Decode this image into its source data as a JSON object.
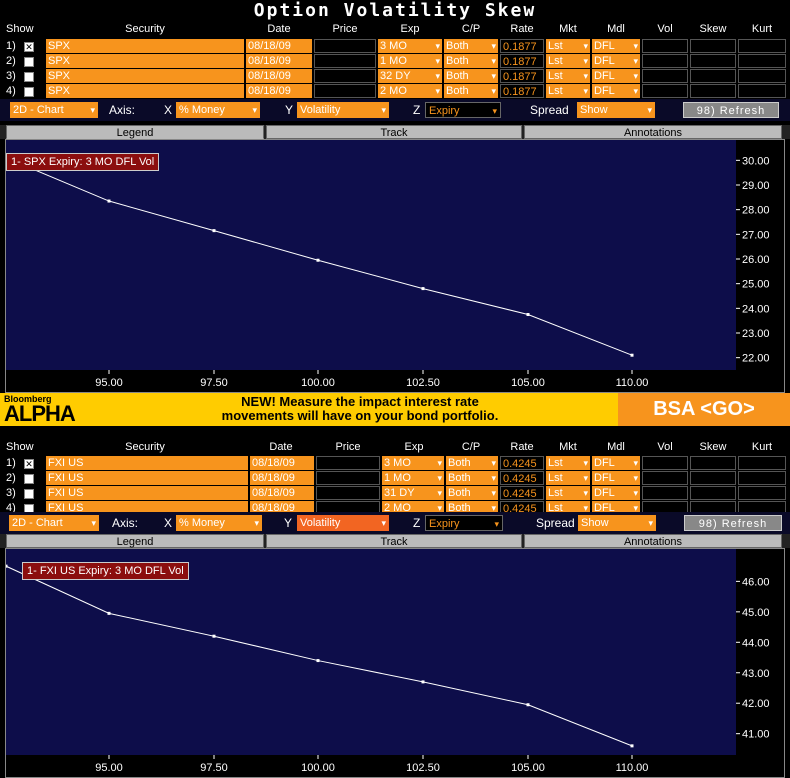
{
  "title": "Option Volatility Skew",
  "columns": [
    "Show",
    "Security",
    "Date",
    "Price",
    "Exp",
    "C/P",
    "Rate",
    "Mkt",
    "Mdl",
    "Vol",
    "Skew",
    "Kurt"
  ],
  "panels": [
    {
      "rows": [
        {
          "num": "1)",
          "checked": true,
          "security": "SPX",
          "date": "08/18/09",
          "price": "",
          "exp": "3 MO",
          "cp": "Both",
          "rate": "0.1877",
          "mkt": "Lst",
          "mdl": "DFL"
        },
        {
          "num": "2)",
          "checked": false,
          "security": "SPX",
          "date": "08/18/09",
          "price": "",
          "exp": "1 MO",
          "cp": "Both",
          "rate": "0.1877",
          "mkt": "Lst",
          "mdl": "DFL"
        },
        {
          "num": "3)",
          "checked": false,
          "security": "SPX",
          "date": "08/18/09",
          "price": "",
          "exp": "32 DY",
          "cp": "Both",
          "rate": "0.1877",
          "mkt": "Lst",
          "mdl": "DFL"
        },
        {
          "num": "4)",
          "checked": false,
          "security": "SPX",
          "date": "08/18/09",
          "price": "",
          "exp": "2 MO",
          "cp": "Both",
          "rate": "0.1877",
          "mkt": "Lst",
          "mdl": "DFL"
        }
      ],
      "controls": {
        "chart": "2D - Chart",
        "axis_label": "Axis:",
        "x_label": "X",
        "x_value": "% Money",
        "y_label": "Y",
        "y_value": "Volatility",
        "z_label": "Z",
        "z_value": "Expiry",
        "spread_label": "Spread",
        "spread_value": "Show",
        "refresh": "98) Refresh"
      },
      "tabs": [
        "Legend",
        "Track",
        "Annotations"
      ],
      "legend": "1- SPX Expiry: 3 MO DFL Vol",
      "chart_data": {
        "type": "line",
        "series": [
          {
            "name": "1- SPX Expiry: 3 MO DFL Vol",
            "x": [
              92.5,
              95,
              97.5,
              100,
              102.5,
              105,
              110
            ],
            "y": [
              30.1,
              28.35,
              27.15,
              25.95,
              24.8,
              23.75,
              22.1
            ]
          }
        ],
        "x_ticks": [
          "95.00",
          "97.50",
          "100.00",
          "102.50",
          "105.00",
          "110.00"
        ],
        "x_tick_values": [
          95,
          97.5,
          100,
          102.5,
          105,
          110
        ],
        "y_ticks": [
          "30.00",
          "29.00",
          "28.00",
          "27.00",
          "26.00",
          "25.00",
          "24.00",
          "23.00",
          "22.00"
        ],
        "ylim": [
          21.5,
          30.5
        ]
      }
    },
    {
      "rows": [
        {
          "num": "1)",
          "checked": true,
          "security": "FXI US",
          "date": "08/18/09",
          "price": "",
          "exp": "3 MO",
          "cp": "Both",
          "rate": "0.4245",
          "mkt": "Lst",
          "mdl": "DFL"
        },
        {
          "num": "2)",
          "checked": false,
          "security": "FXI US",
          "date": "08/18/09",
          "price": "",
          "exp": "1 MO",
          "cp": "Both",
          "rate": "0.4245",
          "mkt": "Lst",
          "mdl": "DFL"
        },
        {
          "num": "3)",
          "checked": false,
          "security": "FXI US",
          "date": "08/18/09",
          "price": "",
          "exp": "31 DY",
          "cp": "Both",
          "rate": "0.4245",
          "mkt": "Lst",
          "mdl": "DFL"
        },
        {
          "num": "4)",
          "checked": false,
          "security": "FXI US",
          "date": "08/18/09",
          "price": "",
          "exp": "2 MO",
          "cp": "Both",
          "rate": "0.4245",
          "mkt": "Lst",
          "mdl": "DFL"
        }
      ],
      "controls": {
        "chart": "2D - Chart",
        "axis_label": "Axis:",
        "x_label": "X",
        "x_value": "% Money",
        "y_label": "Y",
        "y_value": "Volatility",
        "z_label": "Z",
        "z_value": "Expiry",
        "spread_label": "Spread",
        "spread_value": "Show",
        "refresh": "98) Refresh"
      },
      "tabs": [
        "Legend",
        "Track",
        "Annotations"
      ],
      "legend": "1- FXI US Expiry: 3 MO DFL Vol",
      "chart_data": {
        "type": "line",
        "series": [
          {
            "name": "1- FXI US Expiry: 3 MO DFL Vol",
            "x": [
              92.5,
              95,
              97.5,
              100,
              102.5,
              105,
              110
            ],
            "y": [
              46.5,
              44.95,
              44.2,
              43.4,
              42.7,
              41.95,
              40.6
            ]
          }
        ],
        "x_ticks": [
          "95.00",
          "97.50",
          "100.00",
          "102.50",
          "105.00",
          "110.00"
        ],
        "x_tick_values": [
          95,
          97.5,
          100,
          102.5,
          105,
          110
        ],
        "y_ticks": [
          "46.00",
          "45.00",
          "44.00",
          "43.00",
          "42.00",
          "41.00"
        ],
        "ylim": [
          40.3,
          46.8
        ]
      }
    }
  ],
  "ad": {
    "brand_small": "Bloomberg",
    "brand": "ALPHA",
    "line1": "NEW! Measure the impact interest rate",
    "line2": "movements will have on your bond portfolio.",
    "cta": "BSA <GO>"
  },
  "colors": {
    "orange": "#f7941d",
    "chart_bg": "#0d0d4a",
    "legend_bg": "#8b0e0e",
    "ad_bg": "#ffcc00"
  }
}
